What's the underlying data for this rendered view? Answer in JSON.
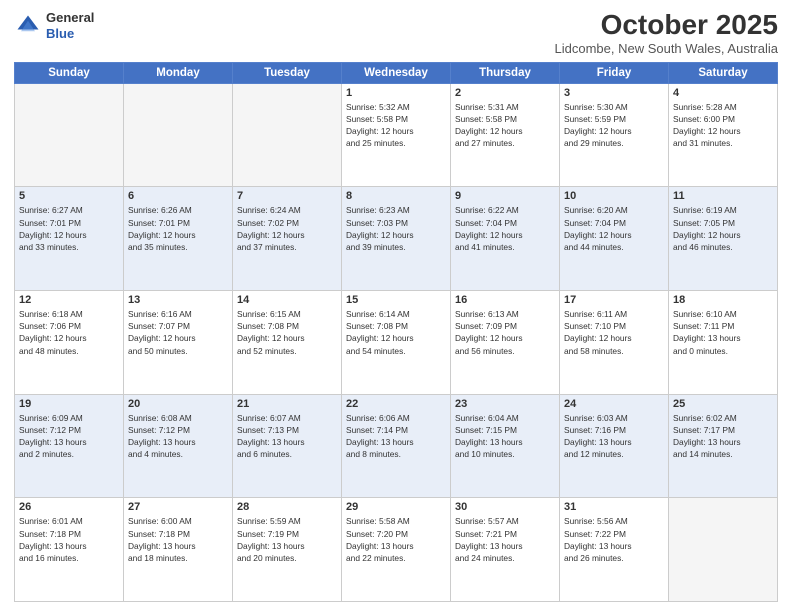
{
  "header": {
    "logo_general": "General",
    "logo_blue": "Blue",
    "month_title": "October 2025",
    "location": "Lidcombe, New South Wales, Australia"
  },
  "weekdays": [
    "Sunday",
    "Monday",
    "Tuesday",
    "Wednesday",
    "Thursday",
    "Friday",
    "Saturday"
  ],
  "weeks": [
    {
      "style": "row-white",
      "days": [
        {
          "num": "",
          "info": ""
        },
        {
          "num": "",
          "info": ""
        },
        {
          "num": "",
          "info": ""
        },
        {
          "num": "1",
          "info": "Sunrise: 5:32 AM\nSunset: 5:58 PM\nDaylight: 12 hours\nand 25 minutes."
        },
        {
          "num": "2",
          "info": "Sunrise: 5:31 AM\nSunset: 5:58 PM\nDaylight: 12 hours\nand 27 minutes."
        },
        {
          "num": "3",
          "info": "Sunrise: 5:30 AM\nSunset: 5:59 PM\nDaylight: 12 hours\nand 29 minutes."
        },
        {
          "num": "4",
          "info": "Sunrise: 5:28 AM\nSunset: 6:00 PM\nDaylight: 12 hours\nand 31 minutes."
        }
      ]
    },
    {
      "style": "row-blue",
      "days": [
        {
          "num": "5",
          "info": "Sunrise: 6:27 AM\nSunset: 7:01 PM\nDaylight: 12 hours\nand 33 minutes."
        },
        {
          "num": "6",
          "info": "Sunrise: 6:26 AM\nSunset: 7:01 PM\nDaylight: 12 hours\nand 35 minutes."
        },
        {
          "num": "7",
          "info": "Sunrise: 6:24 AM\nSunset: 7:02 PM\nDaylight: 12 hours\nand 37 minutes."
        },
        {
          "num": "8",
          "info": "Sunrise: 6:23 AM\nSunset: 7:03 PM\nDaylight: 12 hours\nand 39 minutes."
        },
        {
          "num": "9",
          "info": "Sunrise: 6:22 AM\nSunset: 7:04 PM\nDaylight: 12 hours\nand 41 minutes."
        },
        {
          "num": "10",
          "info": "Sunrise: 6:20 AM\nSunset: 7:04 PM\nDaylight: 12 hours\nand 44 minutes."
        },
        {
          "num": "11",
          "info": "Sunrise: 6:19 AM\nSunset: 7:05 PM\nDaylight: 12 hours\nand 46 minutes."
        }
      ]
    },
    {
      "style": "row-white",
      "days": [
        {
          "num": "12",
          "info": "Sunrise: 6:18 AM\nSunset: 7:06 PM\nDaylight: 12 hours\nand 48 minutes."
        },
        {
          "num": "13",
          "info": "Sunrise: 6:16 AM\nSunset: 7:07 PM\nDaylight: 12 hours\nand 50 minutes."
        },
        {
          "num": "14",
          "info": "Sunrise: 6:15 AM\nSunset: 7:08 PM\nDaylight: 12 hours\nand 52 minutes."
        },
        {
          "num": "15",
          "info": "Sunrise: 6:14 AM\nSunset: 7:08 PM\nDaylight: 12 hours\nand 54 minutes."
        },
        {
          "num": "16",
          "info": "Sunrise: 6:13 AM\nSunset: 7:09 PM\nDaylight: 12 hours\nand 56 minutes."
        },
        {
          "num": "17",
          "info": "Sunrise: 6:11 AM\nSunset: 7:10 PM\nDaylight: 12 hours\nand 58 minutes."
        },
        {
          "num": "18",
          "info": "Sunrise: 6:10 AM\nSunset: 7:11 PM\nDaylight: 13 hours\nand 0 minutes."
        }
      ]
    },
    {
      "style": "row-blue",
      "days": [
        {
          "num": "19",
          "info": "Sunrise: 6:09 AM\nSunset: 7:12 PM\nDaylight: 13 hours\nand 2 minutes."
        },
        {
          "num": "20",
          "info": "Sunrise: 6:08 AM\nSunset: 7:12 PM\nDaylight: 13 hours\nand 4 minutes."
        },
        {
          "num": "21",
          "info": "Sunrise: 6:07 AM\nSunset: 7:13 PM\nDaylight: 13 hours\nand 6 minutes."
        },
        {
          "num": "22",
          "info": "Sunrise: 6:06 AM\nSunset: 7:14 PM\nDaylight: 13 hours\nand 8 minutes."
        },
        {
          "num": "23",
          "info": "Sunrise: 6:04 AM\nSunset: 7:15 PM\nDaylight: 13 hours\nand 10 minutes."
        },
        {
          "num": "24",
          "info": "Sunrise: 6:03 AM\nSunset: 7:16 PM\nDaylight: 13 hours\nand 12 minutes."
        },
        {
          "num": "25",
          "info": "Sunrise: 6:02 AM\nSunset: 7:17 PM\nDaylight: 13 hours\nand 14 minutes."
        }
      ]
    },
    {
      "style": "row-white",
      "days": [
        {
          "num": "26",
          "info": "Sunrise: 6:01 AM\nSunset: 7:18 PM\nDaylight: 13 hours\nand 16 minutes."
        },
        {
          "num": "27",
          "info": "Sunrise: 6:00 AM\nSunset: 7:18 PM\nDaylight: 13 hours\nand 18 minutes."
        },
        {
          "num": "28",
          "info": "Sunrise: 5:59 AM\nSunset: 7:19 PM\nDaylight: 13 hours\nand 20 minutes."
        },
        {
          "num": "29",
          "info": "Sunrise: 5:58 AM\nSunset: 7:20 PM\nDaylight: 13 hours\nand 22 minutes."
        },
        {
          "num": "30",
          "info": "Sunrise: 5:57 AM\nSunset: 7:21 PM\nDaylight: 13 hours\nand 24 minutes."
        },
        {
          "num": "31",
          "info": "Sunrise: 5:56 AM\nSunset: 7:22 PM\nDaylight: 13 hours\nand 26 minutes."
        },
        {
          "num": "",
          "info": ""
        }
      ]
    }
  ]
}
